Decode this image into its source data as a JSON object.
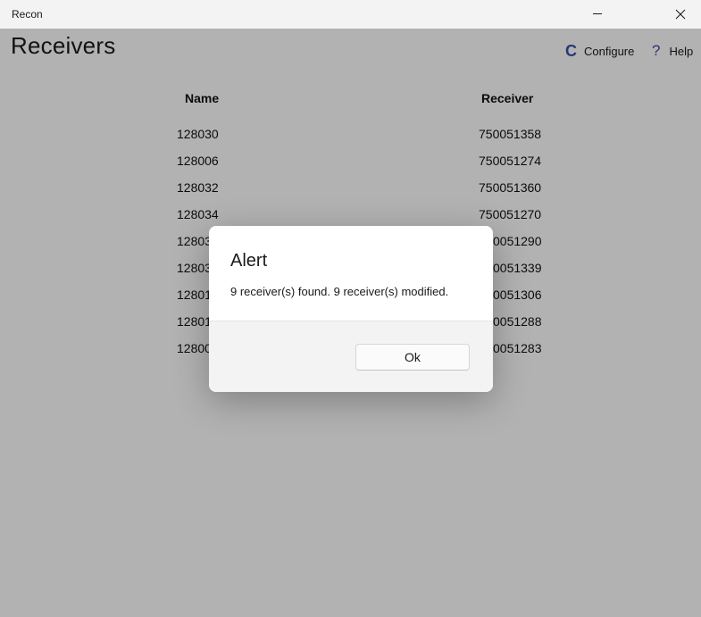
{
  "window": {
    "app_name": "Recon"
  },
  "page": {
    "title": "Receivers"
  },
  "commands": {
    "configure_label": "Configure",
    "configure_glyph": "C",
    "help_label": "Help",
    "help_glyph": "?"
  },
  "table": {
    "headers": {
      "name": "Name",
      "receiver": "Receiver"
    },
    "rows": [
      {
        "name": "128030",
        "receiver": "750051358"
      },
      {
        "name": "128006",
        "receiver": "750051274"
      },
      {
        "name": "128032",
        "receiver": "750051360"
      },
      {
        "name": "128034",
        "receiver": "750051270"
      },
      {
        "name": "12803",
        "receiver": "0051290"
      },
      {
        "name": "12803",
        "receiver": "0051339"
      },
      {
        "name": "12801",
        "receiver": "0051306"
      },
      {
        "name": "12801",
        "receiver": "0051288"
      },
      {
        "name": "12800",
        "receiver": "0051283"
      }
    ]
  },
  "dialog": {
    "title": "Alert",
    "message": "9 receiver(s) found. 9 receiver(s) modified.",
    "ok_label": "Ok"
  },
  "colors": {
    "accent_icon": "#3a4fa8",
    "overlay": "rgba(0,0,0,0.30)"
  }
}
